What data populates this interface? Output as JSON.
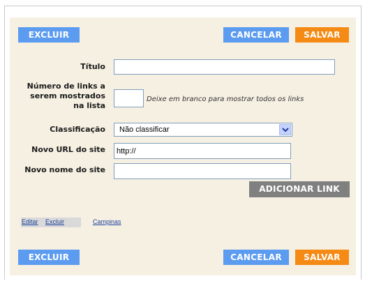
{
  "top_buttons": {
    "delete": "EXCLUIR",
    "cancel": "CANCELAR",
    "save": "SALVAR"
  },
  "form": {
    "title_label": "Título",
    "title_value": "",
    "count_label_lines": [
      "Número de links a",
      "serem mostrados",
      "na lista"
    ],
    "count_value": "",
    "count_hint": "Deixe em branco para mostrar todos os links",
    "sort_label": "Classificação",
    "sort_selected": "Não classificar",
    "new_url_label": "Novo URL do site",
    "new_url_value": "http://",
    "new_name_label": "Novo nome do site",
    "new_name_value": "",
    "add_link_button": "ADICIONAR LINK"
  },
  "footer_links": {
    "edit": "Editar",
    "delete": "Excluir",
    "fields": "Campinas"
  },
  "bottom_buttons": {
    "delete": "EXCLUIR",
    "cancel": "CANCELAR",
    "save": "SALVAR"
  },
  "colors": {
    "blue_button": "#5b9bf0",
    "orange_button": "#f58a15",
    "gray_button": "#808080",
    "panel": "#f6f0e3"
  },
  "icons": {
    "dropdown": "chevron-down-icon"
  }
}
